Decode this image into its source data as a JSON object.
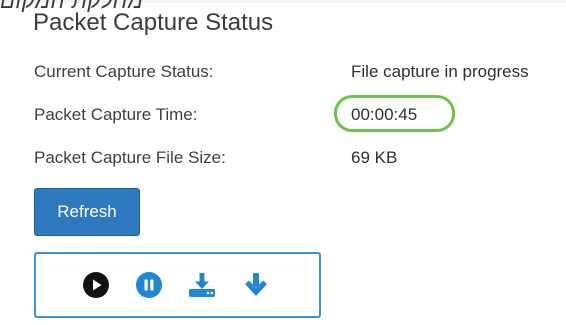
{
  "overlay_heading": "מחלקת המקום",
  "section": {
    "title": "Packet Capture Status"
  },
  "status_rows": [
    {
      "label": "Current Capture Status:",
      "value": "File capture in progress"
    },
    {
      "label": "Packet Capture Time:",
      "value": "00:00:45"
    },
    {
      "label": "Packet Capture File Size:",
      "value": "69 KB"
    }
  ],
  "buttons": {
    "refresh_label": "Refresh"
  },
  "controls": {
    "icons": [
      "play-icon",
      "pause-icon",
      "download-to-device-icon",
      "download-arrow-icon"
    ]
  },
  "colors": {
    "accent_blue": "#2e78bd",
    "icon_blue": "#1f87d6",
    "highlight_green": "#6cc24a",
    "icon_dark": "#111111"
  }
}
